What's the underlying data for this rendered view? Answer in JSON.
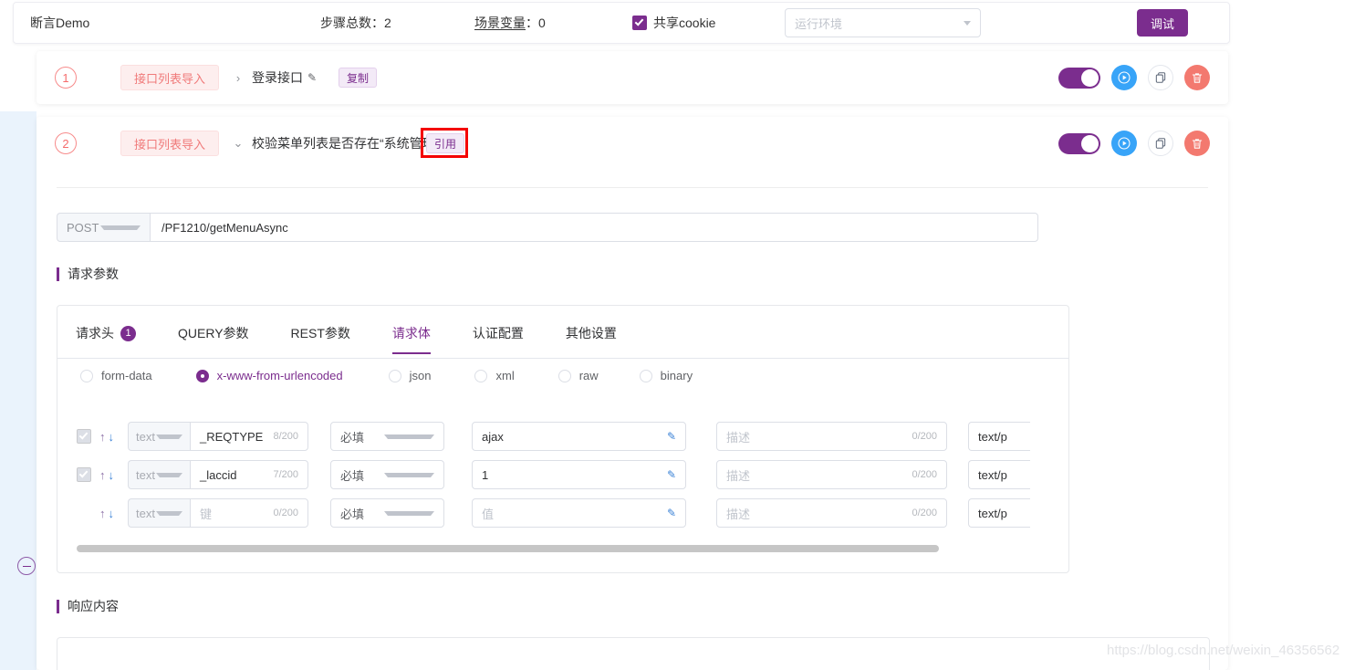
{
  "header": {
    "title": "断言Demo",
    "steps_total_label": "步骤总数：2",
    "scene_var_label": "场景变量",
    "scene_var_sep": "：",
    "scene_var_value": "0",
    "share_cookie_label": "共享cookie",
    "env_placeholder": "运行环境",
    "debug_label": "调试"
  },
  "steps": [
    {
      "number": "1",
      "source_tag": "接口列表导入",
      "chevron": "›",
      "name": "登录接口",
      "pencil": "✎",
      "mini_tag": "复制"
    },
    {
      "number": "2",
      "source_tag": "接口列表导入",
      "chevron": "⌄",
      "name": "校验菜单列表是否存在“系统管理”",
      "mini_tag": "引用"
    }
  ],
  "request": {
    "method": "POST",
    "url": "/PF1210/getMenuAsync",
    "section_title": "请求参数",
    "tabs": [
      {
        "label": "请求头",
        "badge": "1",
        "active": false
      },
      {
        "label": "QUERY参数",
        "badge": "",
        "active": false
      },
      {
        "label": "REST参数",
        "badge": "",
        "active": false
      },
      {
        "label": "请求体",
        "badge": "",
        "active": true
      },
      {
        "label": "认证配置",
        "badge": "",
        "active": false
      },
      {
        "label": "其他设置",
        "badge": "",
        "active": false
      }
    ],
    "body_types": [
      {
        "label": "form-data",
        "selected": false
      },
      {
        "label": "x-www-from-urlencoded",
        "selected": true
      },
      {
        "label": "json",
        "selected": false
      },
      {
        "label": "xml",
        "selected": false
      },
      {
        "label": "raw",
        "selected": false
      },
      {
        "label": "binary",
        "selected": false
      }
    ],
    "rows": [
      {
        "checked": true,
        "type": "text",
        "key": "_REQTYPE",
        "key_count": "8/200",
        "required": "必填",
        "value": "ajax",
        "desc_placeholder": "描述",
        "desc_count": "0/200",
        "mime": "text/p"
      },
      {
        "checked": true,
        "type": "text",
        "key": "_laccid",
        "key_count": "7/200",
        "required": "必填",
        "value": "1",
        "desc_placeholder": "描述",
        "desc_count": "0/200",
        "mime": "text/p"
      },
      {
        "checked": false,
        "type": "text",
        "key_placeholder": "键",
        "key_count": "0/200",
        "required": "必填",
        "value_placeholder": "值",
        "desc_placeholder": "描述",
        "desc_count": "0/200",
        "mime": "text/p"
      }
    ],
    "arrow_up": "↑",
    "arrow_down": "↓",
    "pencil": "✎"
  },
  "response": {
    "section_title": "响应内容"
  },
  "watermark": "https://blog.csdn.net/weixin_46356562",
  "colors": {
    "accent_purple": "#7b2d8e",
    "step_red": "#f56c6c",
    "play_blue": "#38a4f8",
    "delete_red": "#f3796f",
    "annotation_red": "#f40000",
    "band_blue": "#eaf3fc"
  }
}
